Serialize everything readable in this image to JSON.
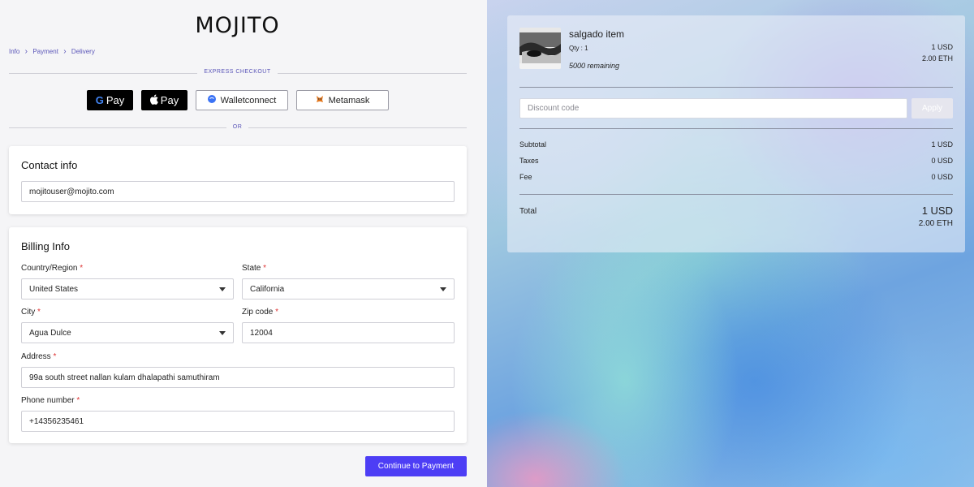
{
  "brand": {
    "logo": "MOJITO"
  },
  "breadcrumb": {
    "items": [
      "Info",
      "Payment",
      "Delivery"
    ]
  },
  "express": {
    "label": "EXPRESS CHECKOUT",
    "or_label": "OR",
    "buttons": {
      "gpay": "Pay",
      "applepay": "Pay",
      "walletconnect": "Walletconnect",
      "metamask": "Metamask"
    }
  },
  "contact": {
    "title": "Contact info",
    "email": "mojitouser@mojito.com"
  },
  "billing": {
    "title": "Billing Info",
    "country_label": "Country/Region",
    "country_value": "United States",
    "state_label": "State",
    "state_value": "California",
    "city_label": "City",
    "city_value": "Agua Dulce",
    "zip_label": "Zip code",
    "zip_value": "12004",
    "address_label": "Address",
    "address_value": "99a south street nallan kulam dhalapathi samuthiram",
    "phone_label": "Phone number",
    "phone_value": "+14356235461",
    "required_mark": "*"
  },
  "actions": {
    "continue_label": "Continue to Payment"
  },
  "summary": {
    "item_name": "salgado item",
    "qty": "Qty : 1",
    "remaining": "5000 remaining",
    "item_price_usd": "1 USD",
    "item_price_eth": "2.00 ETH",
    "discount_placeholder": "Discount code",
    "apply_label": "Apply",
    "subtotal_label": "Subtotal",
    "subtotal_value": "1 USD",
    "taxes_label": "Taxes",
    "taxes_value": "0 USD",
    "fee_label": "Fee",
    "fee_value": "0 USD",
    "total_label": "Total",
    "total_usd": "1 USD",
    "total_eth": "2.00 ETH"
  },
  "colors": {
    "accent": "#4d3ef5",
    "link": "#5a55b8",
    "required": "#dd3333"
  }
}
